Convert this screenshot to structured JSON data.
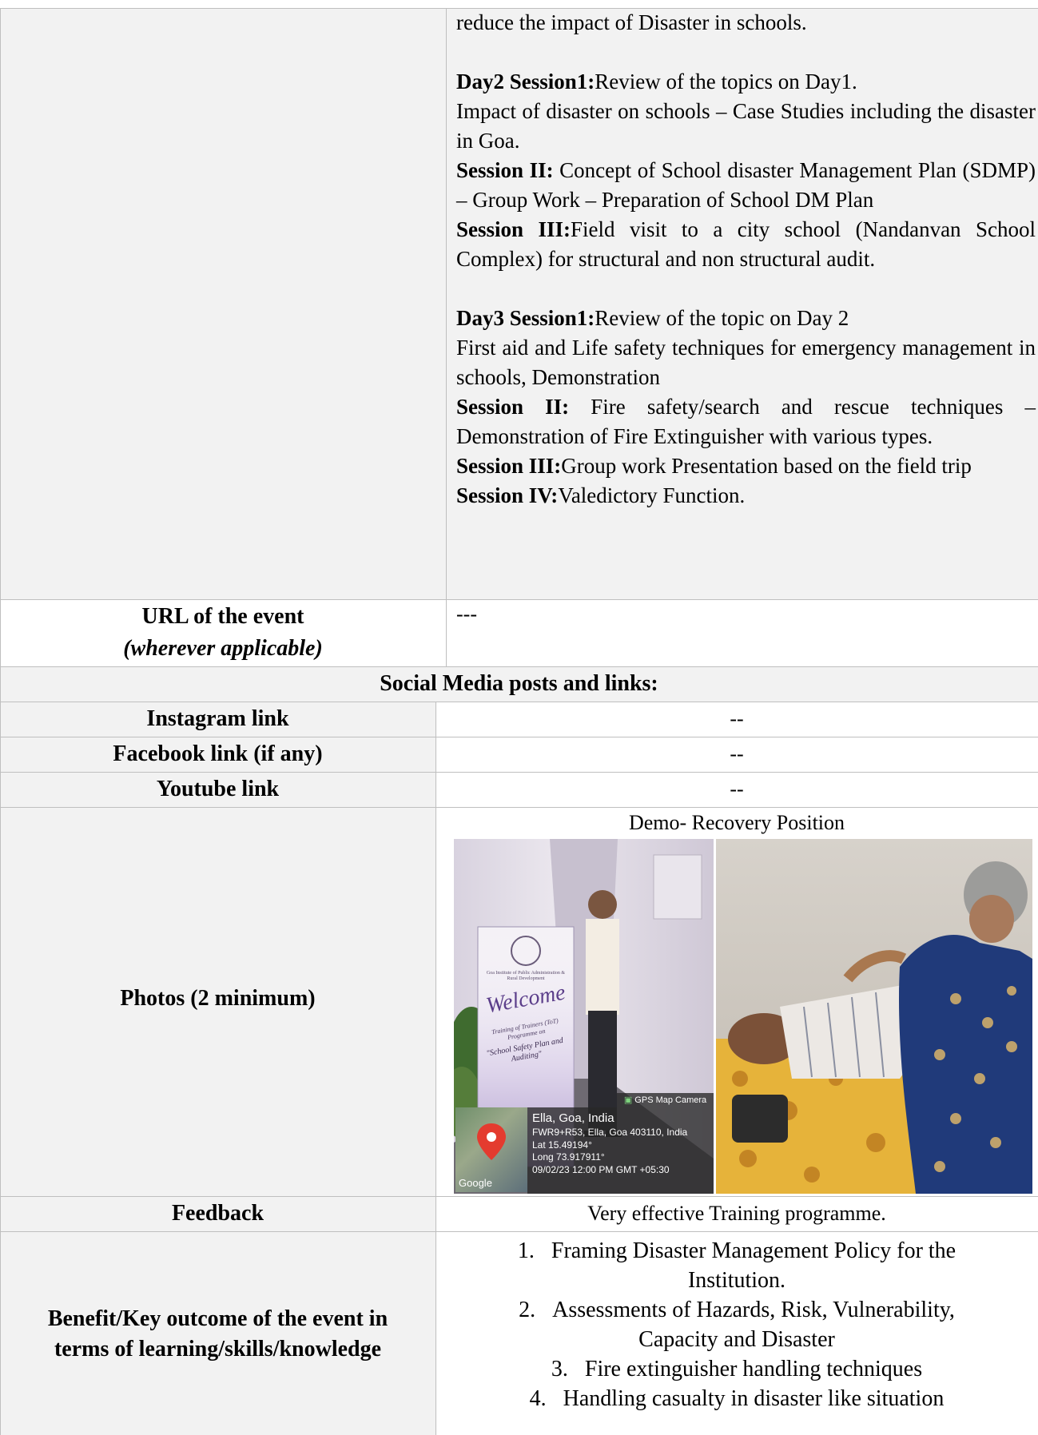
{
  "agenda": {
    "intro_tail": "reduce the impact of Disaster in schools.",
    "day2": {
      "s1_label": "Day2 Session1:",
      "s1_text": "Review of the topics on Day1.",
      "s1_detail": "Impact of disaster on schools – Case Studies including the disaster in Goa.",
      "s2_label": "Session II:",
      "s2_text": " Concept of School disaster Management Plan (SDMP) – Group Work – Preparation of School DM Plan",
      "s3_label": "Session III:",
      "s3_text": "Field visit to a city school (Nandanvan School Complex) for structural and non structural audit."
    },
    "day3": {
      "s1_label": "Day3 Session1:",
      "s1_text": "Review of the topic on Day 2",
      "s1_detail": "First aid and Life safety techniques for emergency management in schools, Demonstration",
      "s2_label": "Session II:",
      "s2_text": " Fire safety/search and rescue techniques – Demonstration of Fire Extinguisher with various types.",
      "s3_label": "Session III:",
      "s3_text": "Group work Presentation based on the field trip",
      "s4_label": "Session IV:",
      "s4_text": "Valedictory Function."
    }
  },
  "url_row": {
    "label": "URL of the event",
    "sublabel": "(wherever applicable)",
    "value": "---"
  },
  "social": {
    "heading": "Social Media posts and links:",
    "instagram_label": "Instagram link",
    "instagram_value": "--",
    "facebook_label": "Facebook link (if any)",
    "facebook_value": "--",
    "youtube_label": "Youtube link",
    "youtube_value": "--"
  },
  "photos": {
    "label": "Photos (2 minimum)",
    "caption": "Demo- Recovery Position",
    "banner_text": "Welcome",
    "banner_sub": "Training of Trainers (ToT) Programme on",
    "banner_title": "\"School Safety Plan and Auditing\"",
    "banner_org": "Goa Institute of Public Administration & Rural Development",
    "gps_app": "GPS Map Camera",
    "gps_place": "Ella, Goa, India",
    "gps_address": "FWR9+R53, Ella, Goa 403110, India",
    "gps_lat": "Lat 15.49194°",
    "gps_long": "Long 73.917911°",
    "gps_time": "09/02/23 12:00 PM GMT +05:30",
    "map_brand": "Google"
  },
  "feedback": {
    "label": "Feedback",
    "value": "Very effective Training programme."
  },
  "benefit": {
    "label_line1": "Benefit/Key outcome of the event in",
    "label_line2": "terms of learning/skills/knowledge",
    "items": [
      {
        "num": "1.",
        "line1": "Framing Disaster Management Policy for the",
        "line2": "Institution."
      },
      {
        "num": "2.",
        "line1": "Assessments of Hazards, Risk, Vulnerability,",
        "line2": "Capacity and Disaster"
      },
      {
        "num": "3.",
        "line1": "Fire extinguisher handling techniques",
        "line2": ""
      },
      {
        "num": "4.",
        "line1": "Handling casualty in disaster like situation",
        "line2": ""
      }
    ]
  }
}
